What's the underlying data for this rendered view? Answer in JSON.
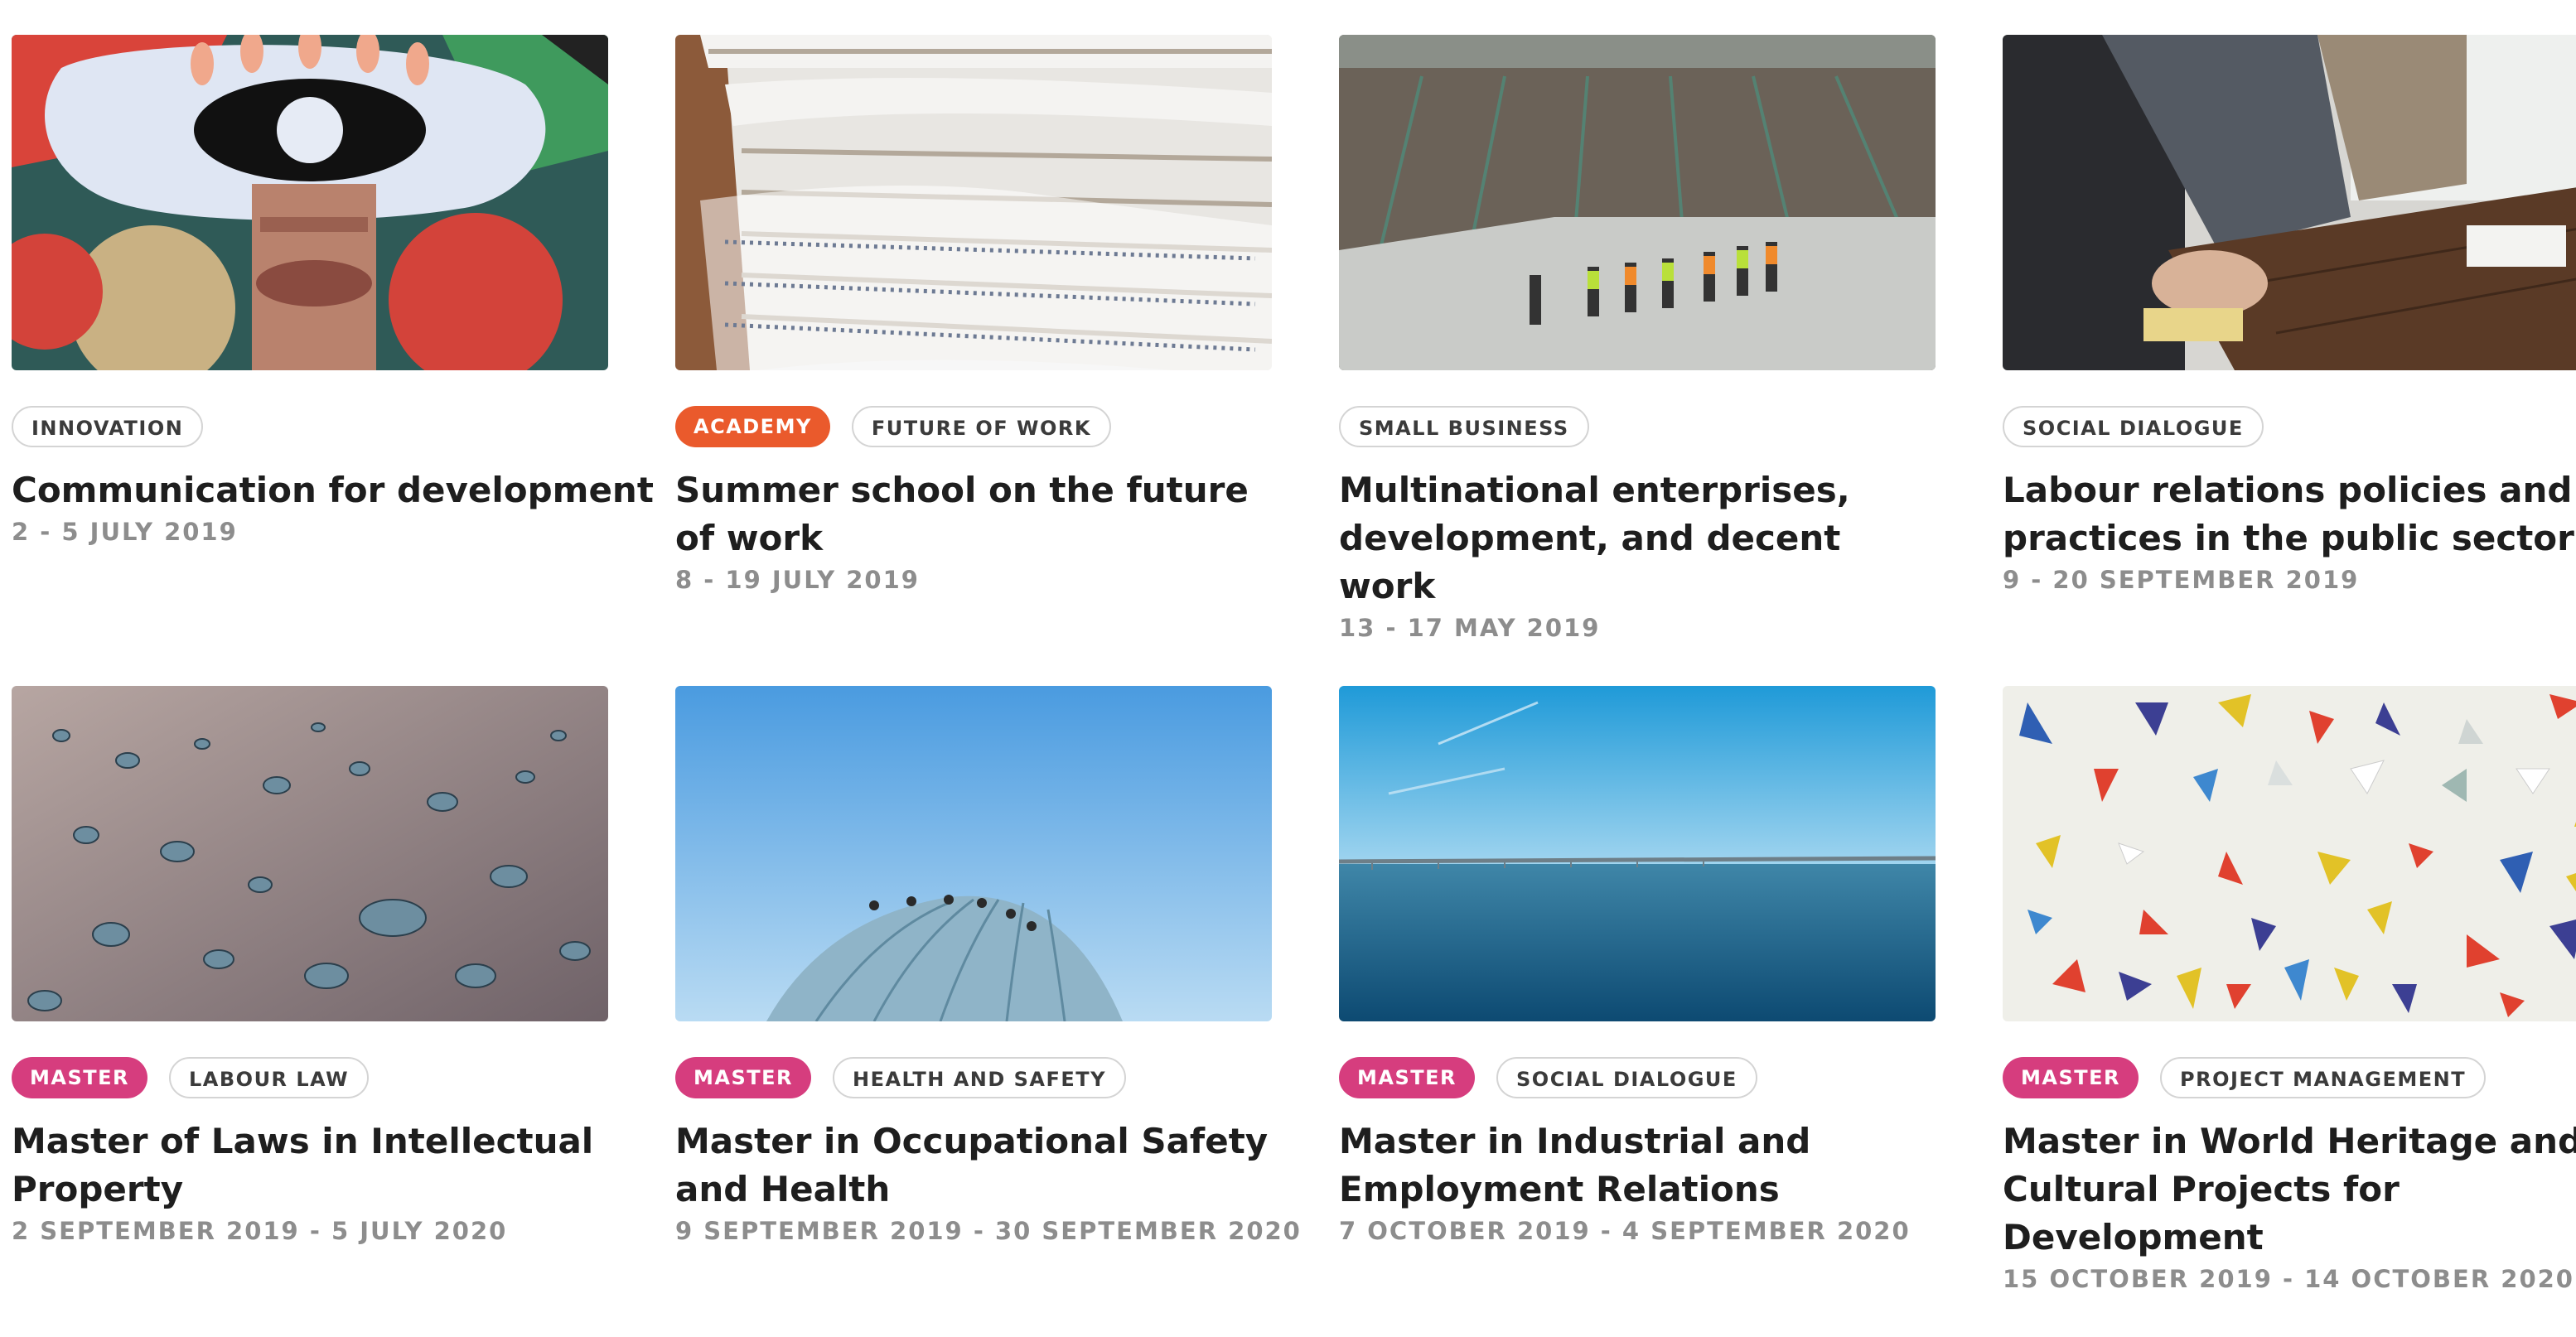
{
  "colors": {
    "academy": "#ea5a2c",
    "master": "#d63d7e",
    "tag_border": "#d4d4d4",
    "title": "#1e1e1e",
    "date": "#8d8d8d"
  },
  "cards": [
    {
      "image": "collage-eye-face-image",
      "tags": [
        {
          "label": "INNOVATION",
          "style": "outline"
        }
      ],
      "title": "Communication for development",
      "date": "2 - 5 JULY 2019"
    },
    {
      "image": "library-shelves-image",
      "tags": [
        {
          "label": "ACADEMY",
          "style": "academy"
        },
        {
          "label": "FUTURE OF WORK",
          "style": "outline"
        }
      ],
      "title": "Summer school on the future of work",
      "date": "8 - 19 JULY 2019"
    },
    {
      "image": "construction-site-image",
      "tags": [
        {
          "label": "SMALL BUSINESS",
          "style": "outline"
        }
      ],
      "title": "Multinational enterprises, development, and decent work",
      "date": "13 - 17 MAY 2019"
    },
    {
      "image": "meeting-table-image",
      "tags": [
        {
          "label": "SOCIAL DIALOGUE",
          "style": "outline"
        }
      ],
      "title": "Labour relations policies and practices in the public sector",
      "date": "9 - 20 SEPTEMBER 2019"
    },
    {
      "image": "water-droplets-image",
      "tags": [
        {
          "label": "MASTER",
          "style": "master"
        },
        {
          "label": "LABOUR LAW",
          "style": "outline"
        }
      ],
      "title": "Master of Laws in Intellectual Property",
      "date": "2 SEPTEMBER 2019 - 5 JULY 2020"
    },
    {
      "image": "dome-climbers-image",
      "tags": [
        {
          "label": "MASTER",
          "style": "master"
        },
        {
          "label": "HEALTH AND SAFETY",
          "style": "outline"
        }
      ],
      "title": "Master in Occupational Safety and Health",
      "date": "9 SEPTEMBER 2019 - 30 SEPTEMBER 2020"
    },
    {
      "image": "sea-bridge-image",
      "tags": [
        {
          "label": "MASTER",
          "style": "master"
        },
        {
          "label": "SOCIAL DIALOGUE",
          "style": "outline"
        }
      ],
      "title": "Master in Industrial and Employment Relations",
      "date": "7 OCTOBER 2019 - 4 SEPTEMBER 2020"
    },
    {
      "image": "paper-triangles-image",
      "tags": [
        {
          "label": "MASTER",
          "style": "master"
        },
        {
          "label": "PROJECT MANAGEMENT",
          "style": "outline"
        }
      ],
      "title": "Master in World Heritage and Cultural Projects for Development",
      "date": "15 OCTOBER 2019 - 14 OCTOBER 2020"
    }
  ]
}
